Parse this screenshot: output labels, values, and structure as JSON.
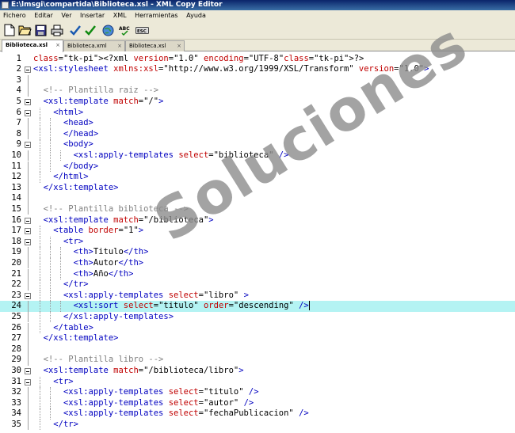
{
  "window": {
    "title": "E:\\lmsgi\\compartida\\Biblioteca.xsl - XML Copy Editor"
  },
  "menu": [
    "Fichero",
    "Editar",
    "Ver",
    "Insertar",
    "XML",
    "Herramientas",
    "Ayuda"
  ],
  "toolbar": {
    "buttons": [
      {
        "icon": "new-file-icon"
      },
      {
        "icon": "open-folder-icon"
      },
      {
        "icon": "save-icon"
      },
      {
        "icon": "print-icon"
      },
      {
        "icon": "check-wellformed-icon"
      },
      {
        "icon": "validate-icon"
      },
      {
        "icon": "globe-icon"
      },
      {
        "icon": "spellcheck-icon",
        "label": "ABC"
      },
      {
        "icon": "exit-icon",
        "label": "ESC"
      }
    ]
  },
  "tabs": [
    {
      "label": "Biblioteca.xsl",
      "active": true
    },
    {
      "label": "Biblioteca.xml",
      "active": false
    },
    {
      "label": "Biblioteca.xsl",
      "active": false
    }
  ],
  "editor": {
    "current_line": 24,
    "lines": [
      {
        "n": "1",
        "fold": false,
        "depth": 0,
        "text": "<?xml version=\"1.0\" encoding=\"UTF-8\"?>"
      },
      {
        "n": "2",
        "fold": true,
        "depth": 0,
        "text": "<xsl:stylesheet xmlns:xsl=\"http://www.w3.org/1999/XSL/Transform\" version=\"1.0\">"
      },
      {
        "n": "3",
        "fold": false,
        "depth": 1,
        "text": ""
      },
      {
        "n": "4",
        "fold": false,
        "depth": 1,
        "text": "  <!-- Plantilla raiz -->"
      },
      {
        "n": "5",
        "fold": true,
        "depth": 1,
        "text": "  <xsl:template match=\"/\">"
      },
      {
        "n": "6",
        "fold": true,
        "depth": 2,
        "text": "    <html>"
      },
      {
        "n": "7",
        "fold": false,
        "depth": 3,
        "text": "      <head>"
      },
      {
        "n": "8",
        "fold": false,
        "depth": 3,
        "text": "      </head>"
      },
      {
        "n": "9",
        "fold": true,
        "depth": 3,
        "text": "      <body>"
      },
      {
        "n": "10",
        "fold": false,
        "depth": 4,
        "text": "        <xsl:apply-templates select=\"biblioteca\" />"
      },
      {
        "n": "11",
        "fold": false,
        "depth": 3,
        "text": "      </body>"
      },
      {
        "n": "12",
        "fold": false,
        "depth": 2,
        "text": "    </html>"
      },
      {
        "n": "13",
        "fold": false,
        "depth": 1,
        "text": "  </xsl:template>"
      },
      {
        "n": "14",
        "fold": false,
        "depth": 1,
        "text": ""
      },
      {
        "n": "15",
        "fold": false,
        "depth": 1,
        "text": "  <!-- Plantilla biblioteca -->"
      },
      {
        "n": "16",
        "fold": true,
        "depth": 1,
        "text": "  <xsl:template match=\"/biblioteca\">"
      },
      {
        "n": "17",
        "fold": true,
        "depth": 2,
        "text": "    <table border=\"1\">"
      },
      {
        "n": "18",
        "fold": true,
        "depth": 3,
        "text": "      <tr>"
      },
      {
        "n": "19",
        "fold": false,
        "depth": 4,
        "text": "        <th>Titulo</th>"
      },
      {
        "n": "20",
        "fold": false,
        "depth": 4,
        "text": "        <th>Autor</th>"
      },
      {
        "n": "21",
        "fold": false,
        "depth": 4,
        "text": "        <th>Año</th>"
      },
      {
        "n": "22",
        "fold": false,
        "depth": 3,
        "text": "      </tr>"
      },
      {
        "n": "23",
        "fold": true,
        "depth": 3,
        "text": "      <xsl:apply-templates select=\"libro\" >"
      },
      {
        "n": "24",
        "fold": false,
        "depth": 4,
        "text": "        <xsl:sort select=\"titulo\" order=\"descending\" />"
      },
      {
        "n": "25",
        "fold": false,
        "depth": 3,
        "text": "      </xsl:apply-templates>"
      },
      {
        "n": "26",
        "fold": false,
        "depth": 2,
        "text": "    </table>"
      },
      {
        "n": "27",
        "fold": false,
        "depth": 1,
        "text": "  </xsl:template>"
      },
      {
        "n": "28",
        "fold": false,
        "depth": 1,
        "text": ""
      },
      {
        "n": "29",
        "fold": false,
        "depth": 1,
        "text": "  <!-- Plantilla libro -->"
      },
      {
        "n": "30",
        "fold": true,
        "depth": 1,
        "text": "  <xsl:template match=\"/biblioteca/libro\">"
      },
      {
        "n": "31",
        "fold": true,
        "depth": 2,
        "text": "    <tr>"
      },
      {
        "n": "32",
        "fold": false,
        "depth": 3,
        "text": "      <xsl:apply-templates select=\"titulo\" />"
      },
      {
        "n": "33",
        "fold": false,
        "depth": 3,
        "text": "      <xsl:apply-templates select=\"autor\" />"
      },
      {
        "n": "34",
        "fold": false,
        "depth": 3,
        "text": "      <xsl:apply-templates select=\"fechaPublicacion\" />"
      },
      {
        "n": "35",
        "fold": false,
        "depth": 2,
        "text": "    </tr>"
      }
    ]
  },
  "watermark": "Soluciones"
}
